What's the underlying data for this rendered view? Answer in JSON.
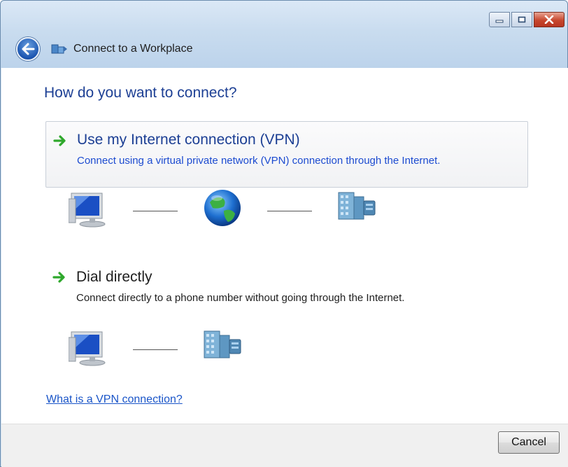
{
  "window": {
    "title": "Connect to a Workplace",
    "icons": {
      "back": "back-arrow-icon",
      "title": "network-connection-icon",
      "minimize": "minimize-icon",
      "maximize": "maximize-icon",
      "close": "close-icon"
    }
  },
  "content": {
    "heading": "How do you want to connect?",
    "options": [
      {
        "title": "Use my Internet connection (VPN)",
        "description": "Connect using a virtual private network (VPN) connection through the Internet.",
        "icon": "green-arrow-icon",
        "diagram": [
          "computer-icon",
          "globe-icon",
          "office-building-icon"
        ]
      },
      {
        "title": "Dial directly",
        "description": "Connect directly to a phone number without going through the Internet.",
        "icon": "green-arrow-icon",
        "diagram": [
          "computer-icon",
          "office-building-icon"
        ]
      }
    ],
    "help_link": "What is a VPN connection?"
  },
  "footer": {
    "cancel_label": "Cancel"
  },
  "colors": {
    "heading_blue": "#1c3f94",
    "link_blue": "#1a55c8",
    "arrow_green": "#2fa82c",
    "close_red": "#c7472e"
  }
}
